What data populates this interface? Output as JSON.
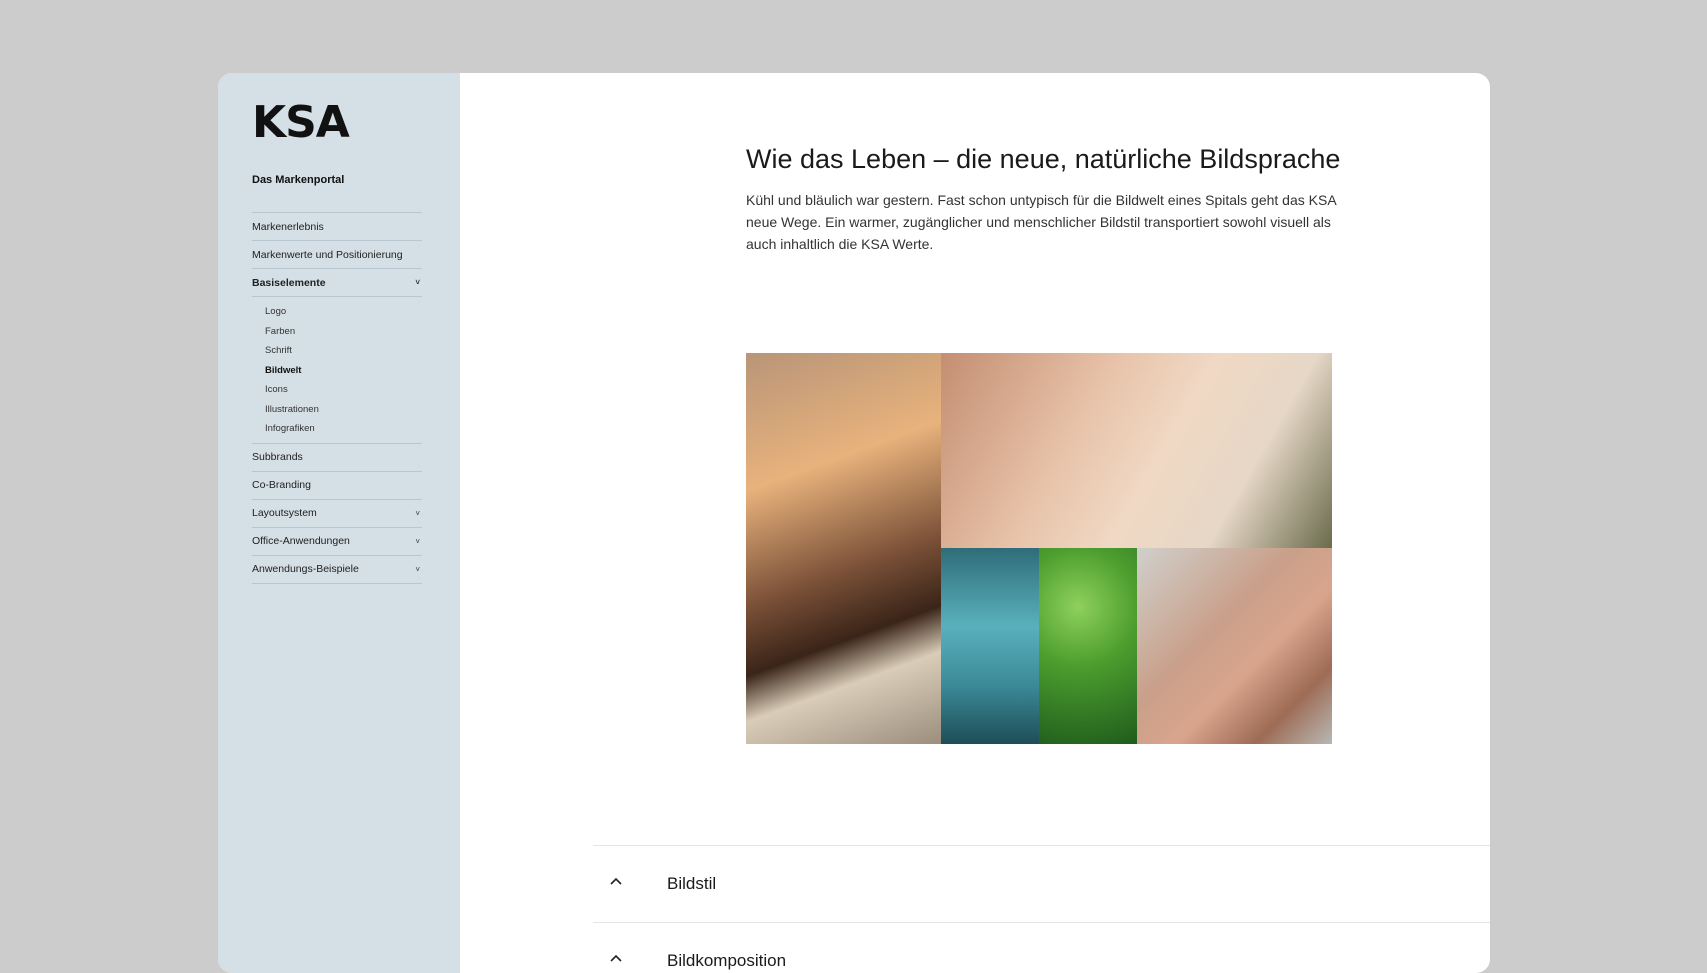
{
  "sidebar": {
    "logo": "KSA",
    "portal_title": "Das Markenportal",
    "items": [
      {
        "label": "Markenerlebnis",
        "chevron": false
      },
      {
        "label": "Markenwerte und Positionierung",
        "chevron": false
      },
      {
        "label": "Basiselemente",
        "chevron": true,
        "active": true
      },
      {
        "label": "Subbrands",
        "chevron": false
      },
      {
        "label": "Co-Branding",
        "chevron": false
      },
      {
        "label": "Layoutsystem",
        "chevron": true
      },
      {
        "label": "Office-Anwendungen",
        "chevron": true
      },
      {
        "label": "Anwendungs-Beispiele",
        "chevron": true
      }
    ],
    "subitems": [
      {
        "label": "Logo"
      },
      {
        "label": "Farben"
      },
      {
        "label": "Schrift"
      },
      {
        "label": "Bildwelt",
        "active": true
      },
      {
        "label": "Icons"
      },
      {
        "label": "Illustrationen"
      },
      {
        "label": "Infografiken"
      }
    ],
    "chevron_glyph": "˅"
  },
  "main": {
    "title": "Wie das Leben – die neue, natürliche Bildsprache",
    "intro": "Kühl und bläulich war gestern. Fast schon untypisch für die Bildwelt eines Spitals geht das KSA neue Wege. Ein warmer, zugänglicher und menschlicher Bildstil transportiert sowohl visuell als auch inhaltlich die KSA Werte."
  },
  "accordion": {
    "items": [
      {
        "label": "Bildstil"
      },
      {
        "label": "Bildkomposition"
      }
    ]
  },
  "colors": {
    "page_bg": "#cccccc",
    "sidebar_bg": "#d5dfe6",
    "content_bg": "#ffffff"
  }
}
